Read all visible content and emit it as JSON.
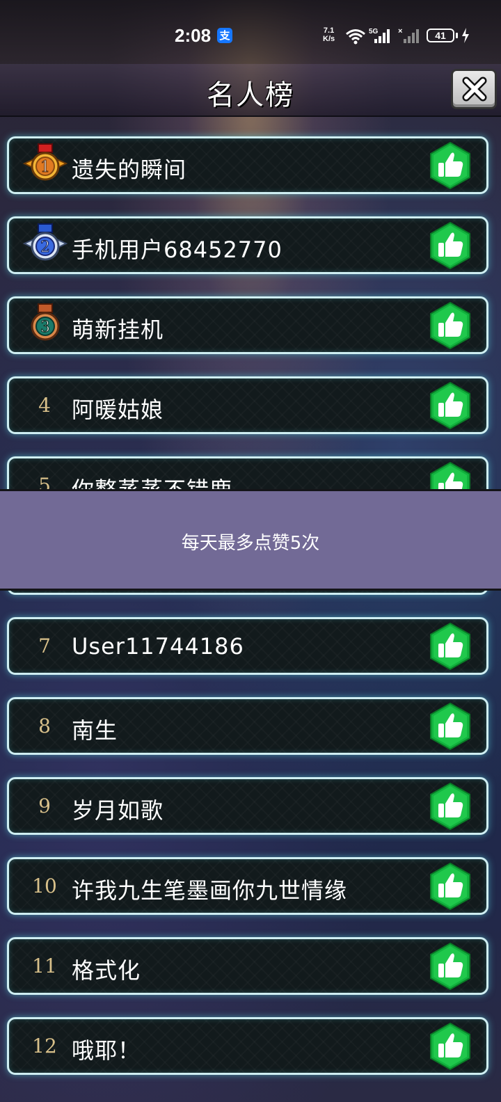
{
  "status_bar": {
    "time": "2:08",
    "net_speed_value": "7.1",
    "net_speed_unit": "K/s",
    "signal_label": "5G",
    "battery": "41"
  },
  "header": {
    "title": "名人榜"
  },
  "colors": {
    "accent_glow": "#5adce6",
    "like_green": "#1fc24a",
    "rank_gold": "#d8c08a",
    "toast_bg": "#726a96"
  },
  "rows": [
    {
      "rank": "1",
      "name": "遗失的瞬间",
      "medal": "gold-medal"
    },
    {
      "rank": "2",
      "name": "手机用户68452770",
      "medal": "silver-medal"
    },
    {
      "rank": "3",
      "name": "萌新挂机",
      "medal": "bronze-medal"
    },
    {
      "rank": "4",
      "name": "阿暖姑娘"
    },
    {
      "rank": "5",
      "name": "你整蒸蒸不错鹿"
    },
    {
      "rank": "7",
      "name": "User11744186"
    },
    {
      "rank": "8",
      "name": "南生"
    },
    {
      "rank": "9",
      "name": "岁月如歌"
    },
    {
      "rank": "10",
      "name": "许我九生笔墨画你九世情缘"
    },
    {
      "rank": "11",
      "name": "格式化"
    },
    {
      "rank": "12",
      "name": "哦耶！"
    }
  ],
  "toast": {
    "message": "每天最多点赞5次"
  }
}
